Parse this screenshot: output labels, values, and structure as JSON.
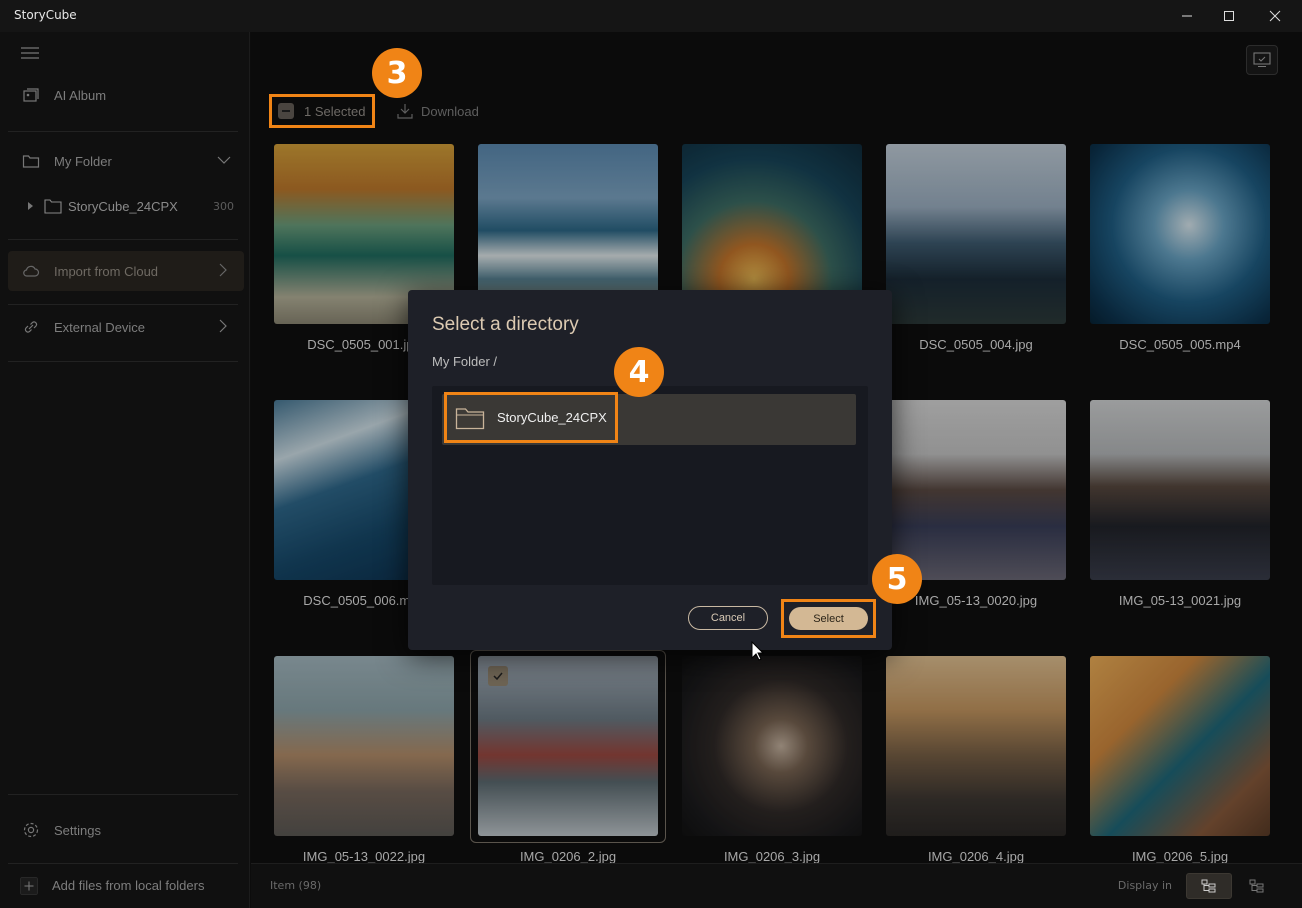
{
  "window": {
    "title": "StoryCube"
  },
  "sidebar": {
    "items": [
      {
        "label": "AI Album",
        "icon": "album-icon"
      },
      {
        "label": "My Folder",
        "icon": "folder-icon"
      },
      {
        "label": "Import from Cloud",
        "icon": "cloud-icon"
      },
      {
        "label": "External Device",
        "icon": "link-icon"
      }
    ],
    "tree": [
      {
        "label": "StoryCube_24CPX",
        "count": "300"
      }
    ],
    "settings_label": "Settings",
    "add_label": "Add files from local folders"
  },
  "toolbar": {
    "selected_label": "1 Selected",
    "download_label": "Download"
  },
  "badges": [
    "3",
    "4",
    "5"
  ],
  "grid": {
    "rows": [
      [
        "DSC_0505_001.jpg",
        "",
        "",
        "DSC_0505_004.jpg",
        "DSC_0505_005.mp4"
      ],
      [
        "DSC_0505_006.mp4",
        "",
        "",
        "IMG_05-13_0020.jpg",
        "IMG_05-13_0021.jpg"
      ],
      [
        "IMG_05-13_0022.jpg",
        "IMG_0206_2.jpg",
        "IMG_0206_3.jpg",
        "IMG_0206_4.jpg",
        "IMG_0206_5.jpg"
      ]
    ]
  },
  "dialog": {
    "title": "Select a directory",
    "breadcrumb": "My Folder  /",
    "folders": [
      "StoryCube_24CPX"
    ],
    "cancel_label": "Cancel",
    "select_label": "Select"
  },
  "statusbar": {
    "items_label": "Item (98)",
    "display_label": "Display in"
  },
  "colors": {
    "accent_orange": "#f08416",
    "select_button": "#d3b894",
    "dialog_bg": "#1e2028"
  }
}
